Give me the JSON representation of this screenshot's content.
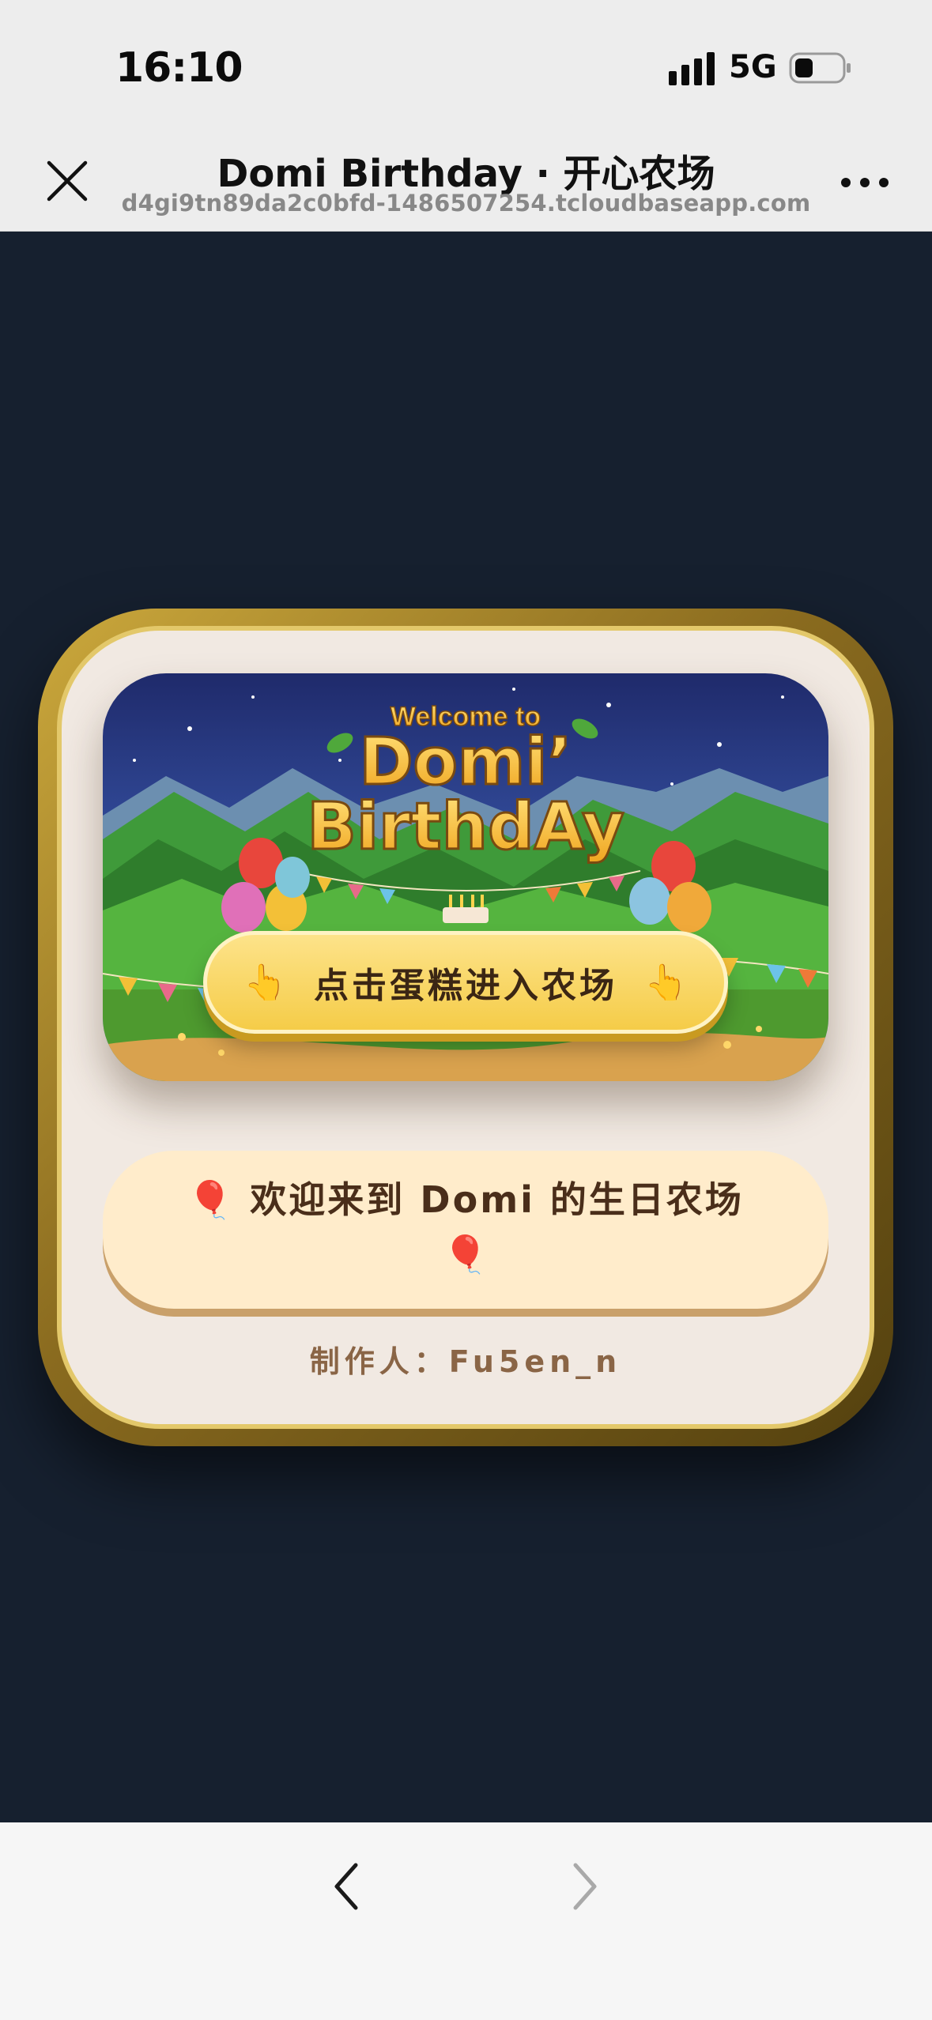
{
  "status_bar": {
    "time": "16:10",
    "network": "5G",
    "icons": [
      "signal-icon",
      "battery-icon"
    ]
  },
  "nav_bar": {
    "title": "Domi Birthday · 开心农场",
    "url": "d4gi9tn89da2c0bfd-1486507254.tcloudbaseapp.com",
    "icons": [
      "close-icon",
      "more-icon"
    ]
  },
  "banner": {
    "welcome_to": "Welcome to",
    "title_line1": "Domi’",
    "title_line2": "BirthdAy"
  },
  "enter_button": {
    "hand_left": "👆",
    "label": "点击蛋糕进入农场",
    "hand_right": "👆"
  },
  "welcome_panel": {
    "balloon_left": "🎈",
    "text": "欢迎来到 Domi 的生日农场",
    "balloon_bottom": "🎈"
  },
  "maker": "制作人：Fu5en_n",
  "bottom_bar": {
    "icons": [
      "back-arrow-icon",
      "forward-arrow-icon"
    ]
  },
  "colors": {
    "page_background": "#16202f",
    "card_gold": "#cba83c",
    "card_cream": "#f1e9e2",
    "button_yellow": "#f5cc48",
    "welcome_panel": "#ffeccb",
    "text_brown": "#4a2e1a"
  }
}
